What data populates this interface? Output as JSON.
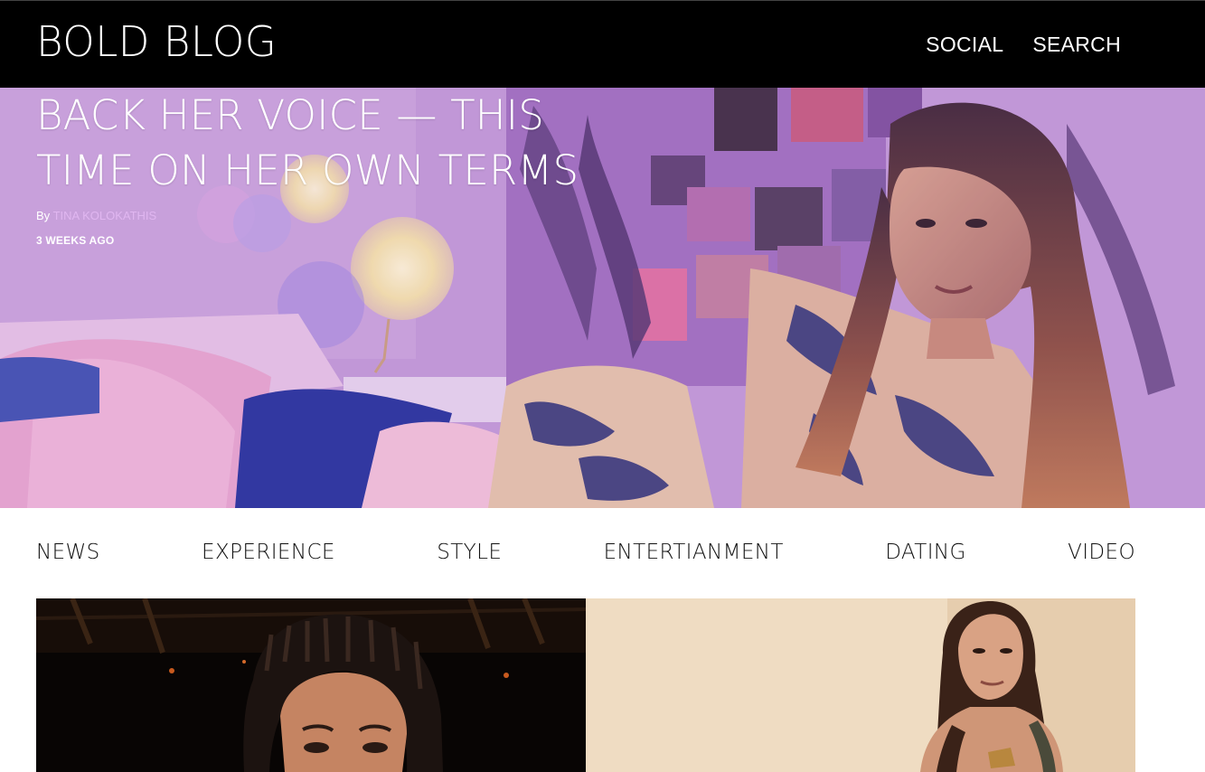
{
  "header": {
    "brand": "BOLD BLOG",
    "nav": [
      "SOCIAL",
      "SEARCH"
    ]
  },
  "hero": {
    "title_line1": "BACK HER VOICE — THIS",
    "title_line2": "TIME ON HER OWN TERMS",
    "by_label": "By",
    "author": "TINA KOLOKATHIS",
    "time_ago": "3 WEEKS AGO"
  },
  "categories": [
    "NEWS",
    "EXPERIENCE",
    "STYLE",
    "ENTERTIANMENT",
    "DATING",
    "VIDEO"
  ],
  "colors": {
    "header_bg": "#000000",
    "author_link": "#e0b6f0",
    "hero_tint": "#b08cd2"
  },
  "icons": []
}
